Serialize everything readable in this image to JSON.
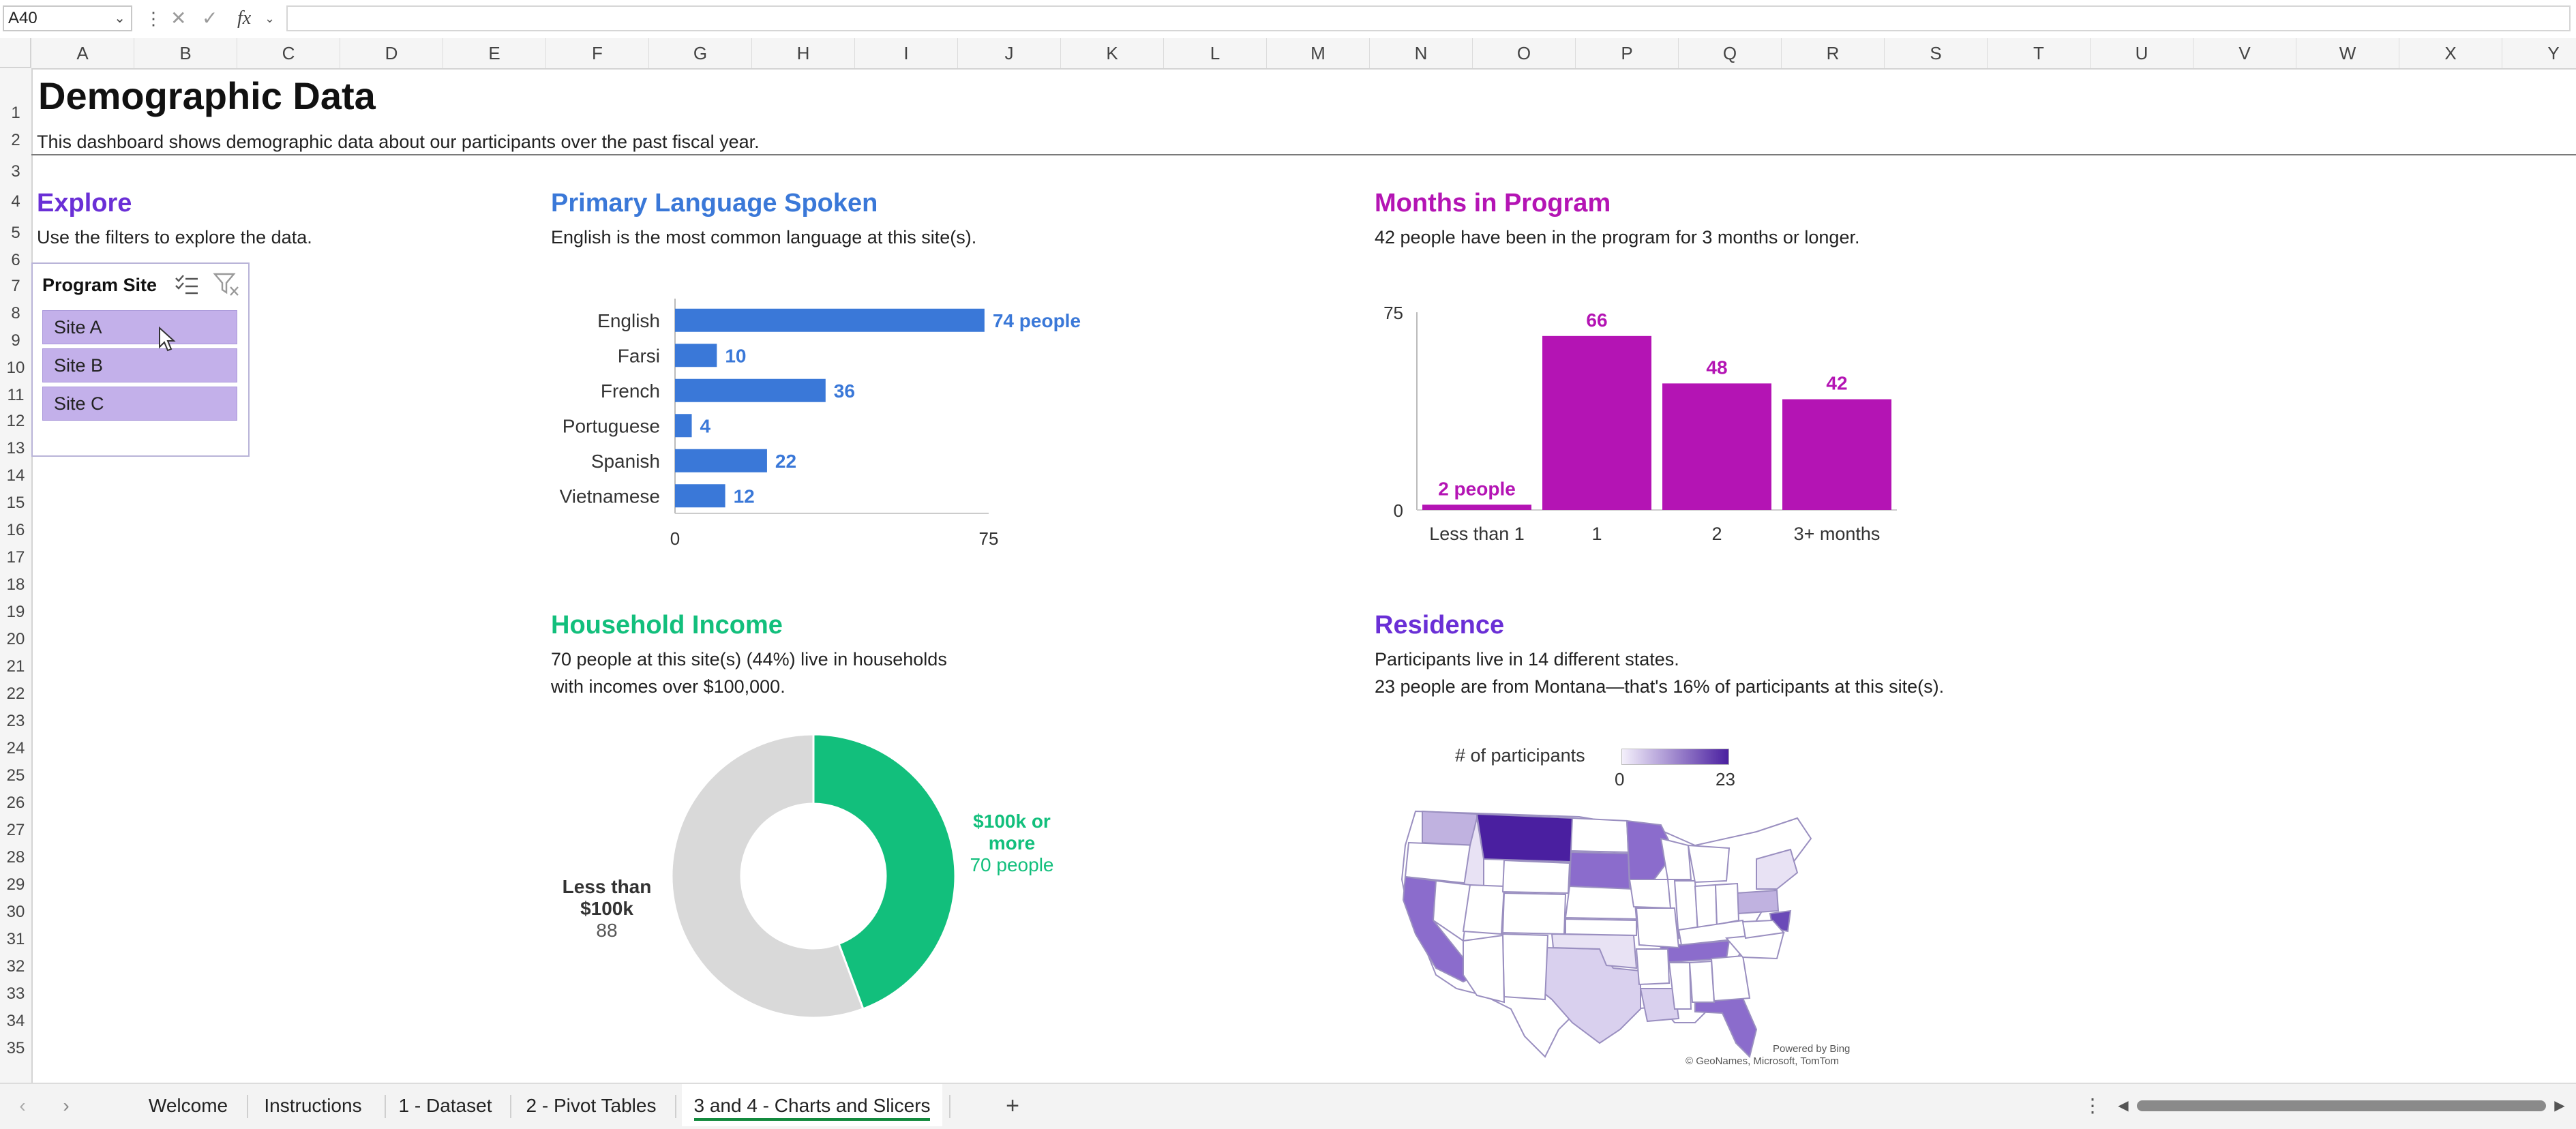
{
  "formula_bar": {
    "name_box": "A40",
    "fx_label": "fx",
    "formula": ""
  },
  "columns": [
    "A",
    "B",
    "C",
    "D",
    "E",
    "F",
    "G",
    "H",
    "I",
    "J",
    "K",
    "L",
    "M",
    "N",
    "O",
    "P",
    "Q",
    "R",
    "S",
    "T",
    "U",
    "V",
    "W",
    "X",
    "Y"
  ],
  "rows": [
    "1",
    "2",
    "3",
    "4",
    "5",
    "6",
    "7",
    "8",
    "9",
    "10",
    "11",
    "12",
    "13",
    "14",
    "15",
    "16",
    "17",
    "18",
    "19",
    "20",
    "21",
    "22",
    "23",
    "24",
    "25",
    "26",
    "27",
    "28",
    "29",
    "30",
    "31",
    "32",
    "33",
    "34",
    "35"
  ],
  "header": {
    "title": "Demographic Data",
    "subtitle": "This dashboard shows demographic data about our participants over the past fiscal year."
  },
  "explore": {
    "title": "Explore",
    "desc": "Use the filters to explore the data.",
    "slicer": {
      "title": "Program Site",
      "items": [
        "Site A",
        "Site B",
        "Site C"
      ]
    }
  },
  "language": {
    "title": "Primary Language Spoken",
    "desc": "English is the most common language at this site(s).",
    "chart_data": {
      "type": "bar",
      "orientation": "horizontal",
      "categories": [
        "English",
        "Farsi",
        "French",
        "Portuguese",
        "Spanish",
        "Vietnamese"
      ],
      "values": [
        74,
        10,
        36,
        4,
        22,
        12
      ],
      "data_labels": [
        "74 people",
        "10",
        "36",
        "4",
        "22",
        "12"
      ],
      "xlim": [
        0,
        75
      ],
      "ticks": [
        "0",
        "75"
      ],
      "color": "#3a78d8"
    }
  },
  "months": {
    "title": "Months in Program",
    "desc": "42 people have been in the program for 3 months or longer.",
    "chart_data": {
      "type": "bar",
      "categories": [
        "Less than 1",
        "1",
        "2",
        "3+ months"
      ],
      "values": [
        2,
        66,
        48,
        42
      ],
      "data_labels": [
        "2 people",
        "66",
        "48",
        "42"
      ],
      "ylim": [
        0,
        75
      ],
      "ticks": [
        "0",
        "75"
      ],
      "color": "#b414b4"
    }
  },
  "income": {
    "title": "Household Income",
    "desc1": "70 people at this site(s) (44%) live in households",
    "desc2": "with incomes over $100,000.",
    "chart_data": {
      "type": "pie",
      "variant": "donut",
      "categories": [
        "$100k or more",
        "Less than $100k"
      ],
      "values": [
        70,
        88
      ],
      "colors": [
        "#12bf7c",
        "#d9d9d9"
      ]
    },
    "label_high_1": "$100k or",
    "label_high_2": "more",
    "label_high_value": "70 people",
    "label_low_1": "Less than",
    "label_low_2": "$100k",
    "label_low_value": "88"
  },
  "residence": {
    "title": "Residence",
    "desc1": "Participants live in 14 different states.",
    "desc2": "23 people are from Montana—that's 16% of participants at this site(s).",
    "legend_title": "# of participants",
    "legend_min": "0",
    "legend_max": "23",
    "credit1": "Powered by Bing",
    "credit2": "© GeoNames, Microsoft, TomTom"
  },
  "tabs": [
    "Welcome",
    "Instructions",
    "1 - Dataset",
    "2 - Pivot Tables",
    "3 and 4 - Charts and Slicers"
  ],
  "active_tab": "3 and 4 - Charts and Slicers",
  "add_sheet": "+",
  "colors": {
    "explore": "#6a2fd6",
    "language": "#3a78d8",
    "months": "#b414b4",
    "income": "#12bf7c",
    "residence": "#6a2fd6"
  }
}
